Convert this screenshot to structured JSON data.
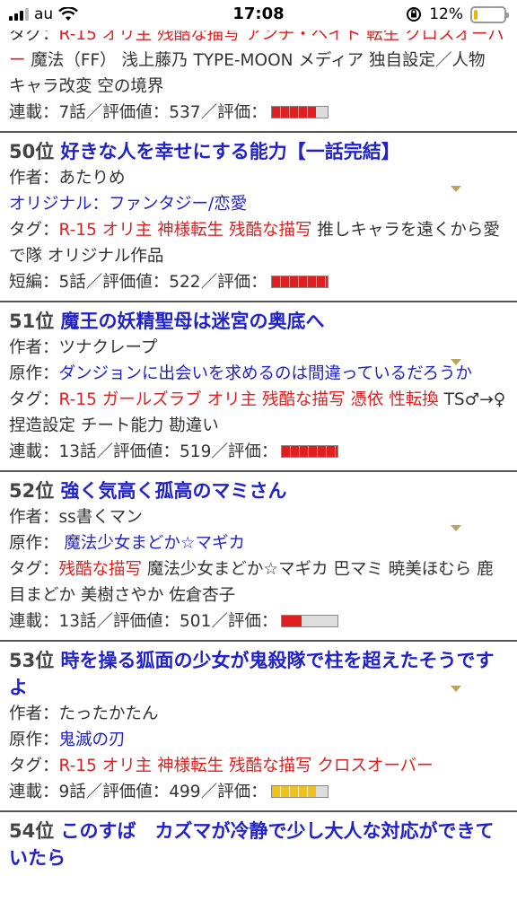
{
  "status_bar": {
    "carrier": "au",
    "time": "17:08",
    "battery": "12%",
    "battery_level": 0.12
  },
  "entries": [
    {
      "tag_label": "タグ：",
      "tags_red": "R-15 オリ主 残酷な描写 アンチ・ヘイト 転生 クロスオーバー",
      "tags_plain": " 魔法（FF） 浅上藤乃 TYPE-MOON メディア 独自設定／人物 キャラ改変 空の境界",
      "stats": "連載：7話／評価値：537／評価：",
      "rating_fill": 0.8,
      "bar_style": "red"
    },
    {
      "rank": "50位",
      "title": "好きな人を幸せにする能力【一話完結】",
      "author_label": "作者：",
      "author": "あたりめ",
      "genre": "オリジナル：ファンタジー/恋愛",
      "tag_label": "タグ：",
      "tags_red": "R-15 オリ主 神様転生 残酷な描写",
      "tags_plain": " 推しキャラを遠くから愛で隊 オリジナル作品",
      "stats": "短編：5話／評価値：522／評価：",
      "rating_fill": 1.0,
      "bar_style": "red"
    },
    {
      "rank": "51位",
      "title": "魔王の妖精聖母は迷宮の奥底へ",
      "author_label": "作者：",
      "author": "ツナクレープ",
      "original_label": "原作：",
      "original": "ダンジョンに出会いを求めるのは間違っているだろうか",
      "tag_label": "タグ：",
      "tags_red": "R-15 ガールズラブ オリ主 残酷な描写 憑依 性転換",
      "tags_plain": " TS♂→♀ 捏造設定 チート能力 勘違い",
      "stats": "連載：13話／評価値：519／評価：",
      "rating_fill": 1.0,
      "bar_style": "red"
    },
    {
      "rank": "52位",
      "title": "強く気高く孤高のマミさん",
      "author_label": "作者：",
      "author": "ss書くマン",
      "original_label": "原作：",
      "original": " 魔法少女まどか☆マギカ",
      "tag_label": "タグ：",
      "tags_red": "残酷な描写",
      "tags_plain": " 魔法少女まどか☆マギカ 巴マミ 暁美ほむら 鹿目まどか 美樹さやか 佐倉杏子",
      "stats": "連載：13話／評価値：501／評価：",
      "rating_fill": 0.35,
      "bar_style": "redpart"
    },
    {
      "rank": "53位",
      "title": "時を操る狐面の少女が鬼殺隊で柱を超えたそうですよ",
      "author_label": "作者：",
      "author": "たったかたん",
      "original_label": "原作：",
      "original": "鬼滅の刃",
      "tag_label": "タグ：",
      "tags_red": "R-15 オリ主 神様転生 残酷な描写 クロスオーバー",
      "tags_plain": "",
      "stats": "連載：9話／評価値：499／評価：",
      "rating_fill": 0.8,
      "bar_style": "yellow"
    },
    {
      "rank": "54位",
      "title": "このすば　カズマが冷静で少し大人な対応ができていたら"
    }
  ]
}
